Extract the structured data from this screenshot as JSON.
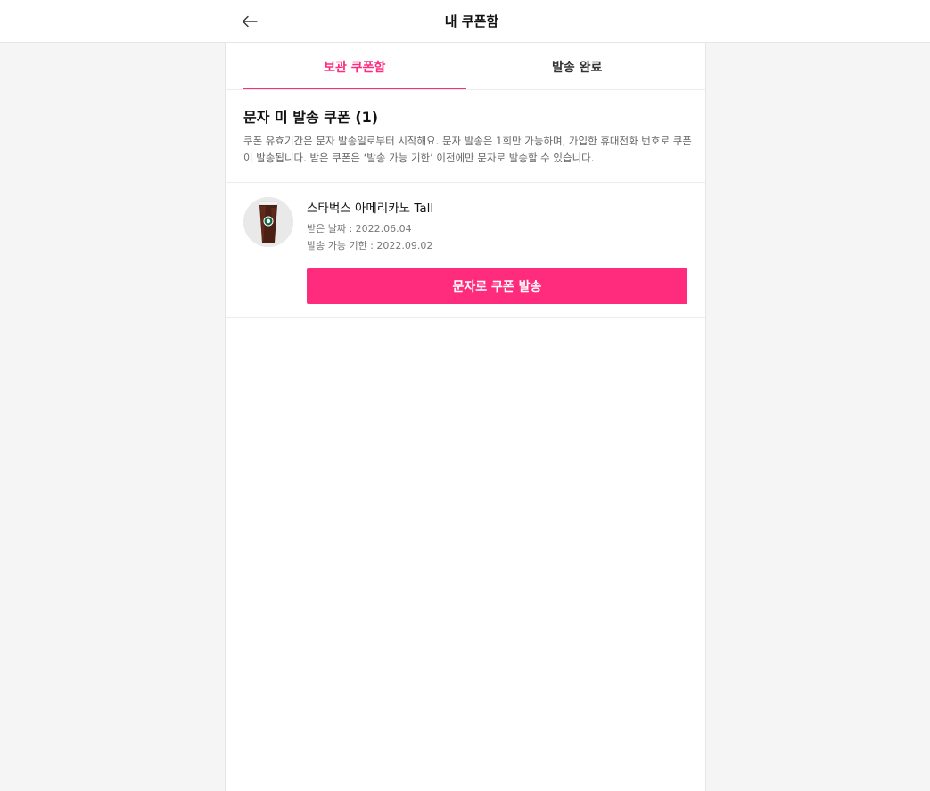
{
  "header": {
    "title": "내 쿠폰함",
    "back_icon": "arrow-left-icon"
  },
  "tabs": [
    {
      "label": "보관 쿠폰함",
      "active": true
    },
    {
      "label": "발송 완료",
      "active": false
    }
  ],
  "section": {
    "title": "문자 미 발송 쿠폰 (1)",
    "description": "쿠폰 유효기간은 문자 발송일로부터 시작해요. 문자 발송은 1회만 가능하며, 가입한 휴대전화 번호로 쿠폰이 발송됩니다. 받은 쿠폰은 ‘발송 가능 기한’ 이전에만 문자로 발송할 수 있습니다."
  },
  "coupons": [
    {
      "name": "스타벅스 아메리카노 Tall",
      "received": "받은 날짜 : 2022.06.04",
      "deadline": "발송 가능 기한 : 2022.09.02",
      "button_label": "문자로 쿠폰 발송",
      "image": "iced-americano-cup-image"
    }
  ],
  "colors": {
    "accent": "#ff2c7d",
    "background": "#f5f5f5",
    "panel": "#ffffff"
  }
}
